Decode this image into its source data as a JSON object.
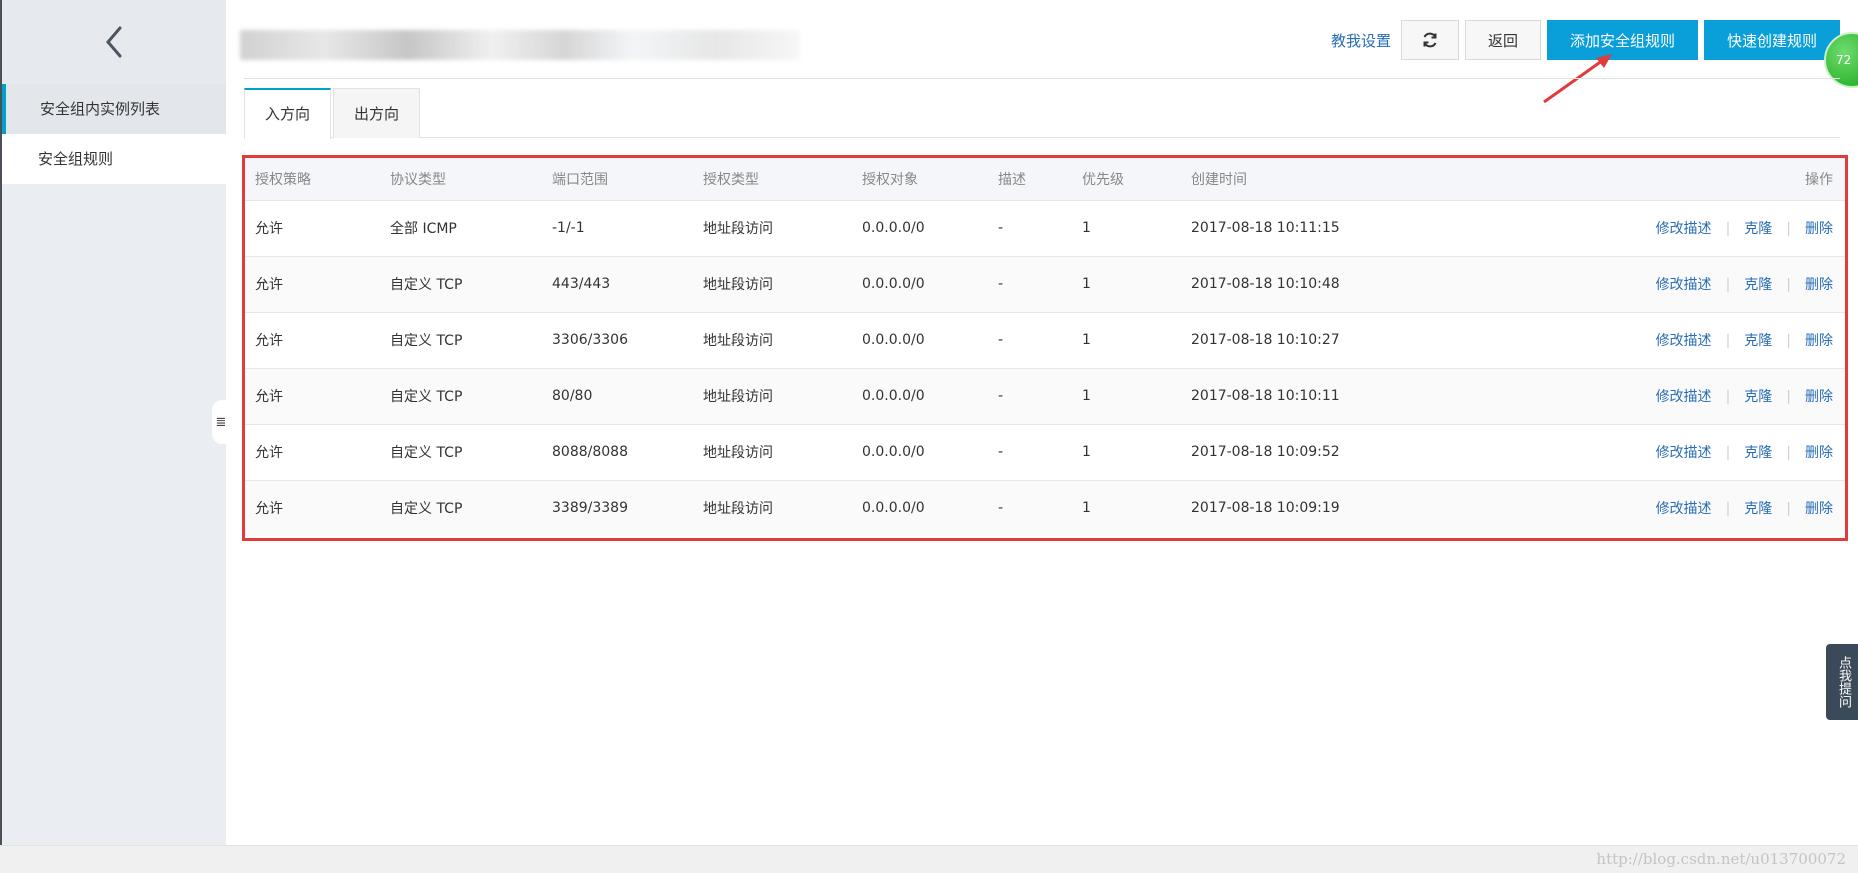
{
  "sidebar": {
    "back_label": "‹",
    "items": [
      {
        "label": "安全组内实例列表"
      },
      {
        "label": "安全组规则"
      }
    ],
    "collapse_glyph": "≣"
  },
  "header": {
    "toolbar": {
      "tutorial_link": "教我设置",
      "refresh_icon": "refresh-icon",
      "back_button": "返回",
      "add_rule_button": "添加安全组规则",
      "quick_create_button": "快速创建规则"
    },
    "badge_text": "72"
  },
  "tabs": [
    {
      "label": "入方向"
    },
    {
      "label": "出方向"
    }
  ],
  "table": {
    "columns": [
      "授权策略",
      "协议类型",
      "端口范围",
      "授权类型",
      "授权对象",
      "描述",
      "优先级",
      "创建时间",
      "操作"
    ],
    "rows": [
      {
        "policy": "允许",
        "protocol": "全部 ICMP",
        "port": "-1/-1",
        "auth_type": "地址段访问",
        "target": "0.0.0.0/0",
        "desc": "-",
        "priority": "1",
        "created": "2017-08-18 10:11:15"
      },
      {
        "policy": "允许",
        "protocol": "自定义 TCP",
        "port": "443/443",
        "auth_type": "地址段访问",
        "target": "0.0.0.0/0",
        "desc": "-",
        "priority": "1",
        "created": "2017-08-18 10:10:48"
      },
      {
        "policy": "允许",
        "protocol": "自定义 TCP",
        "port": "3306/3306",
        "auth_type": "地址段访问",
        "target": "0.0.0.0/0",
        "desc": "-",
        "priority": "1",
        "created": "2017-08-18 10:10:27"
      },
      {
        "policy": "允许",
        "protocol": "自定义 TCP",
        "port": "80/80",
        "auth_type": "地址段访问",
        "target": "0.0.0.0/0",
        "desc": "-",
        "priority": "1",
        "created": "2017-08-18 10:10:11"
      },
      {
        "policy": "允许",
        "protocol": "自定义 TCP",
        "port": "8088/8088",
        "auth_type": "地址段访问",
        "target": "0.0.0.0/0",
        "desc": "-",
        "priority": "1",
        "created": "2017-08-18 10:09:52"
      },
      {
        "policy": "允许",
        "protocol": "自定义 TCP",
        "port": "3389/3389",
        "auth_type": "地址段访问",
        "target": "0.0.0.0/0",
        "desc": "-",
        "priority": "1",
        "created": "2017-08-18 10:09:19"
      }
    ],
    "actions": {
      "edit": "修改描述",
      "clone": "克隆",
      "delete": "删除"
    }
  },
  "help_tab": "点我提问",
  "watermark": "http://blog.csdn.net/u013700072",
  "colors": {
    "accent": "#0a9fd8",
    "link": "#2a6db5",
    "highlight_border": "#e03c3c"
  }
}
